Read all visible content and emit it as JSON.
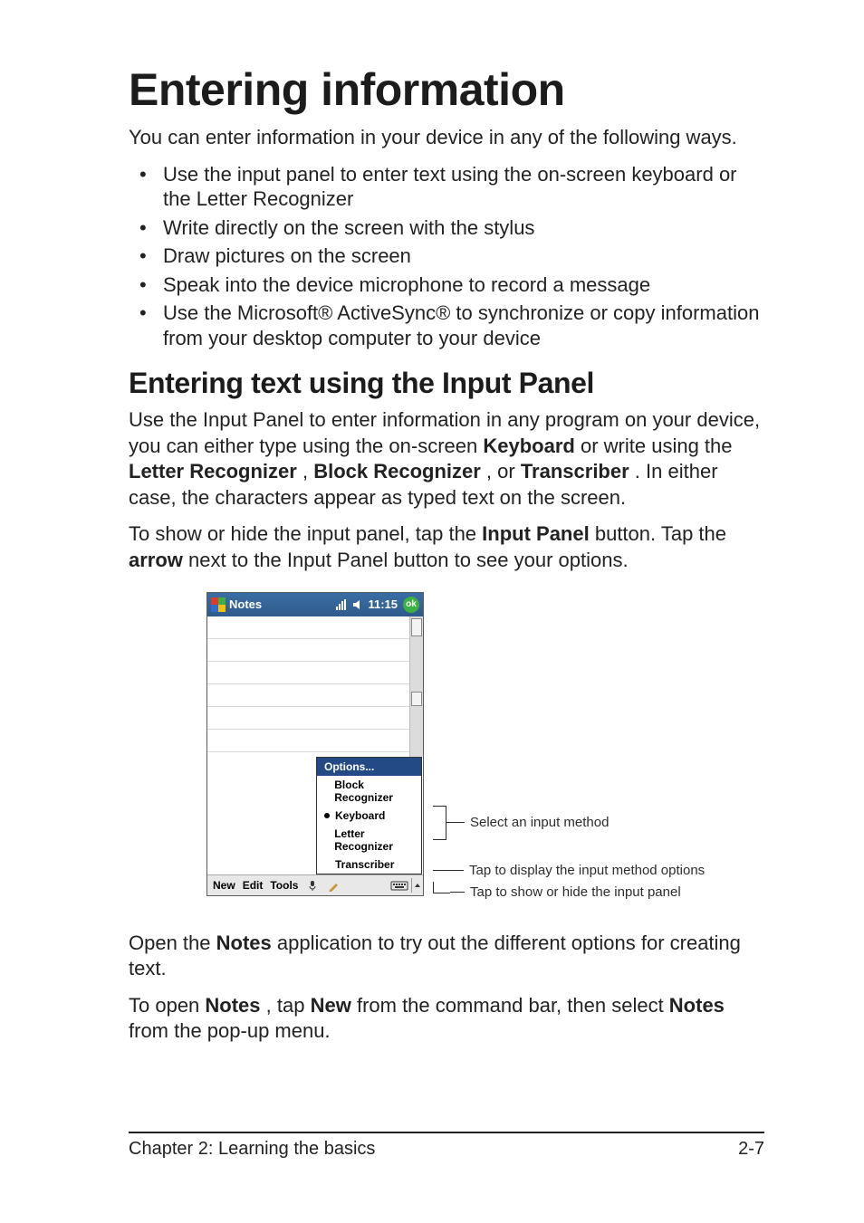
{
  "title": "Entering information",
  "intro": "You can enter information in your device in any of the following ways.",
  "bullets": [
    "Use the input panel to enter text using the on-screen keyboard or the Letter Recognizer",
    "Write directly on the screen with the stylus",
    "Draw pictures on the screen",
    "Speak into the device microphone to record a message",
    "Use the Microsoft® ActiveSync® to synchronize or copy information from your desktop computer to your device"
  ],
  "subtitle": "Entering text using the Input Panel",
  "para1_parts": {
    "a": "Use the Input Panel to enter information in any program on your device, you can either type using the on-screen ",
    "keyboard": "Keyboard",
    "b": " or write using the ",
    "letter": "Letter Recognizer",
    "c": ", ",
    "block": "Block Recognizer",
    "d": ", or ",
    "trans": "Transcriber",
    "e": ". In either case, the characters appear as typed text on the screen."
  },
  "para2_parts": {
    "a": "To show or hide the input panel, tap the ",
    "input_panel": "Input Panel",
    "b": " button. Tap the ",
    "arrow": "arrow",
    "c": " next to the Input Panel button to see your options."
  },
  "screenshot": {
    "app_title": "Notes",
    "clock": "11:15",
    "ok_label": "ok",
    "menu_header": "Options...",
    "menu_items": [
      "Block Recognizer",
      "Keyboard",
      "Letter Recognizer",
      "Transcriber"
    ],
    "selected_index": 1,
    "cmd_new": "New",
    "cmd_edit": "Edit",
    "cmd_tools": "Tools"
  },
  "annotations": {
    "select_method": "Select an input method",
    "display_options": "Tap to display the input method options",
    "show_hide": "Tap to show or hide the input panel"
  },
  "para3_parts": {
    "a": "Open the ",
    "notes": "Notes",
    "b": " application to try out the different options for creating text."
  },
  "para4_parts": {
    "a": "To open ",
    "notes": "Notes",
    "b": ", tap ",
    "new": "New",
    "c": " from the command bar, then select ",
    "notes2": "Notes",
    "d": " from the pop-up menu."
  },
  "footer": {
    "left": "Chapter 2: Learning the basics",
    "right": "2-7"
  }
}
